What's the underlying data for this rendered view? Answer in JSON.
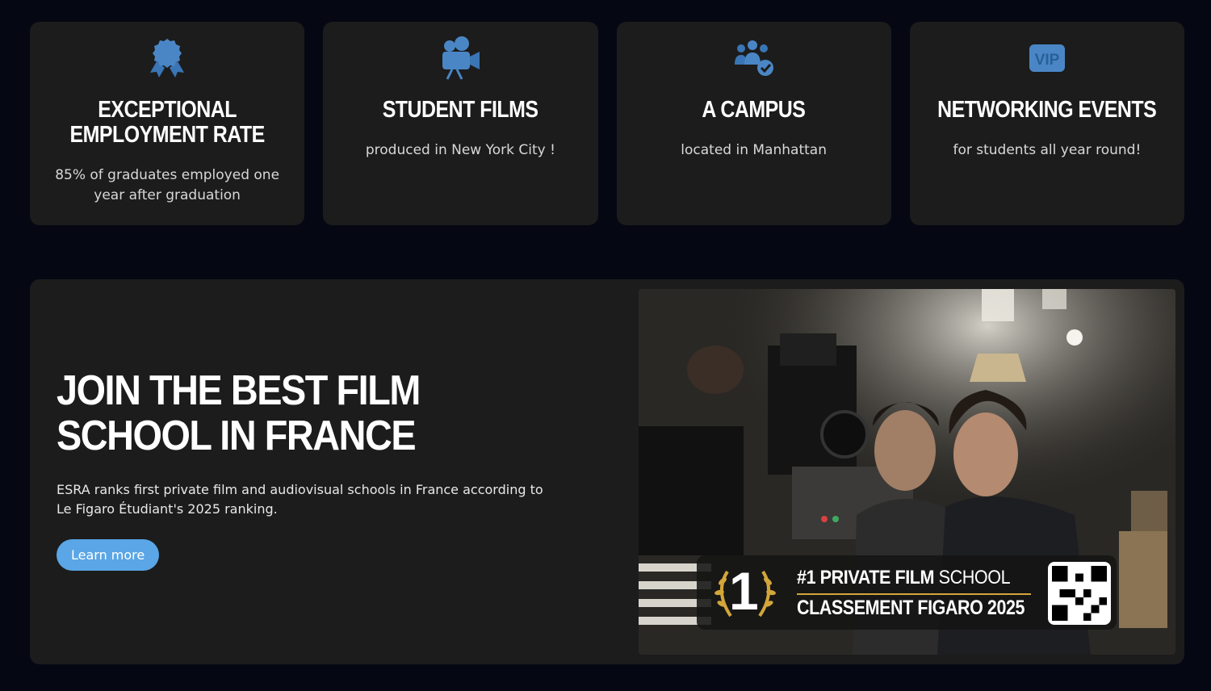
{
  "features": [
    {
      "icon": "award-ribbon-icon",
      "title": "EXCEPTIONAL EMPLOYMENT RATE",
      "text": "85% of graduates employed one year after graduation"
    },
    {
      "icon": "movie-camera-icon",
      "title": "STUDENT FILMS",
      "text": "produced in New York City !"
    },
    {
      "icon": "users-check-icon",
      "title": "A CAMPUS",
      "text": "located in Manhattan"
    },
    {
      "icon": "vip-icon",
      "title": "NETWORKING EVENTS",
      "text": "for students all year round!"
    }
  ],
  "vip_label": "VIP",
  "promo": {
    "title": "JOIN THE BEST FILM SCHOOL IN FRANCE",
    "description": "ESRA ranks first private film and audiovisual schools in France according to Le Figaro Étudiant's 2025 ranking.",
    "button_label": "Learn more"
  },
  "image_badge": {
    "rank": "1",
    "line1_bold": "#1 PRIVATE FILM",
    "line1_light": "SCHOOL",
    "line2": "CLASSEMENT FIGARO 2025"
  },
  "colors": {
    "background": "#050812",
    "card": "#1c1c1c",
    "icon": "#4a86c5",
    "button": "#5aa6e6",
    "gold": "#d3a63a"
  }
}
